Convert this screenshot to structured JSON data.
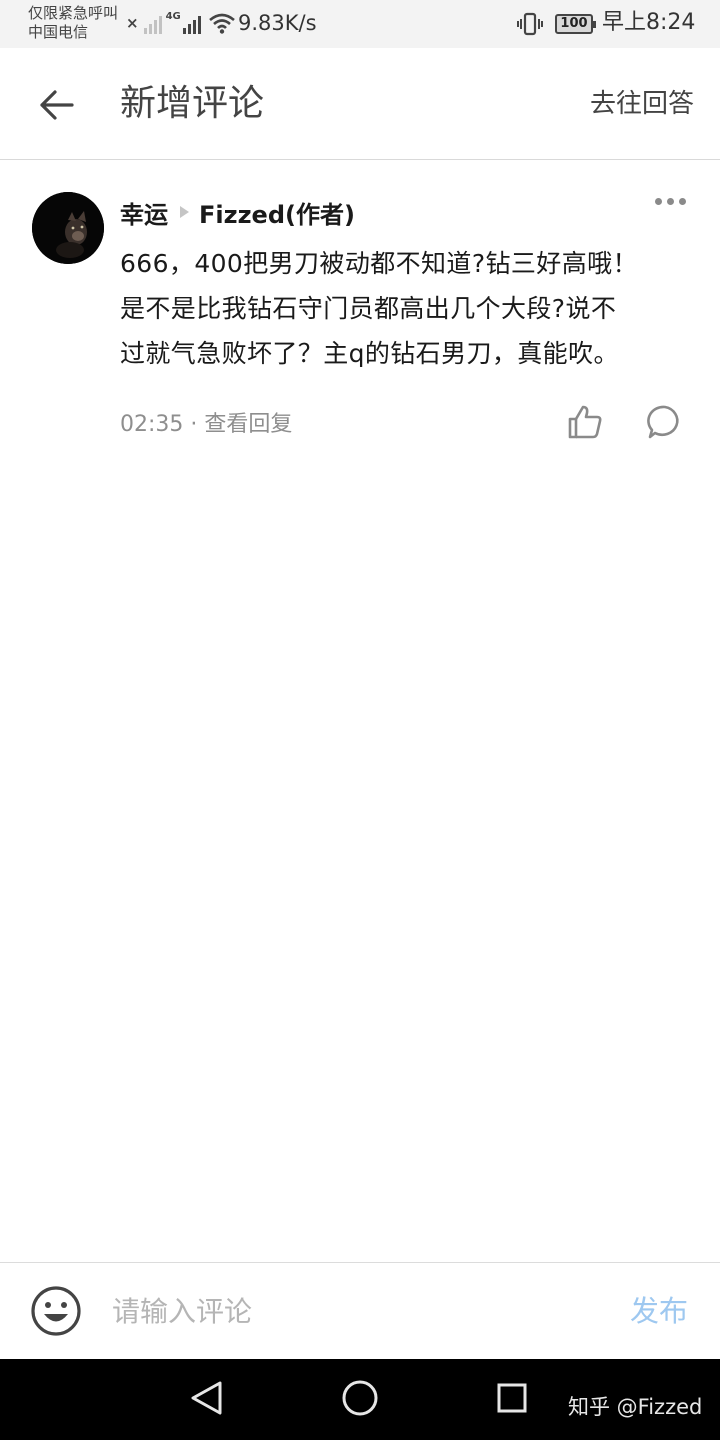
{
  "status_bar": {
    "emergency_text": "仅限紧急呼叫",
    "carrier": "中国电信",
    "network_type": "4G",
    "net_speed": "9.83K/s",
    "battery": "100",
    "time": "早上8:24",
    "icons": [
      "no-sim-signal-icon",
      "signal-icon",
      "wifi-icon",
      "vibrate-icon",
      "battery-icon"
    ]
  },
  "header": {
    "title": "新增评论",
    "action": "去往回答",
    "back_icon": "arrow-left-icon"
  },
  "comment": {
    "author": "幸运",
    "reply_to": "Fizzed(作者)",
    "text": "666，400把男刀被动都不知道?钻三好高哦！\n是不是比我钻石守门员都高出几个大段?说不\n过就气急败坏了？主q的钻石男刀，真能吹。",
    "time": "02:35",
    "separator": "·",
    "view_replies": "查看回复",
    "icons": [
      "avatar-cat-image",
      "more-dots-icon",
      "thumbs-up-icon",
      "comment-bubble-icon"
    ]
  },
  "input_bar": {
    "placeholder": "请输入评论",
    "publish": "发布",
    "publish_color": "#9ec8f0",
    "emoji_icon": "smiley-icon"
  },
  "nav_bar": {
    "icons": [
      "triangle-back-icon",
      "circle-home-icon",
      "square-recent-icon"
    ],
    "watermark": "知乎 @Fizzed"
  }
}
